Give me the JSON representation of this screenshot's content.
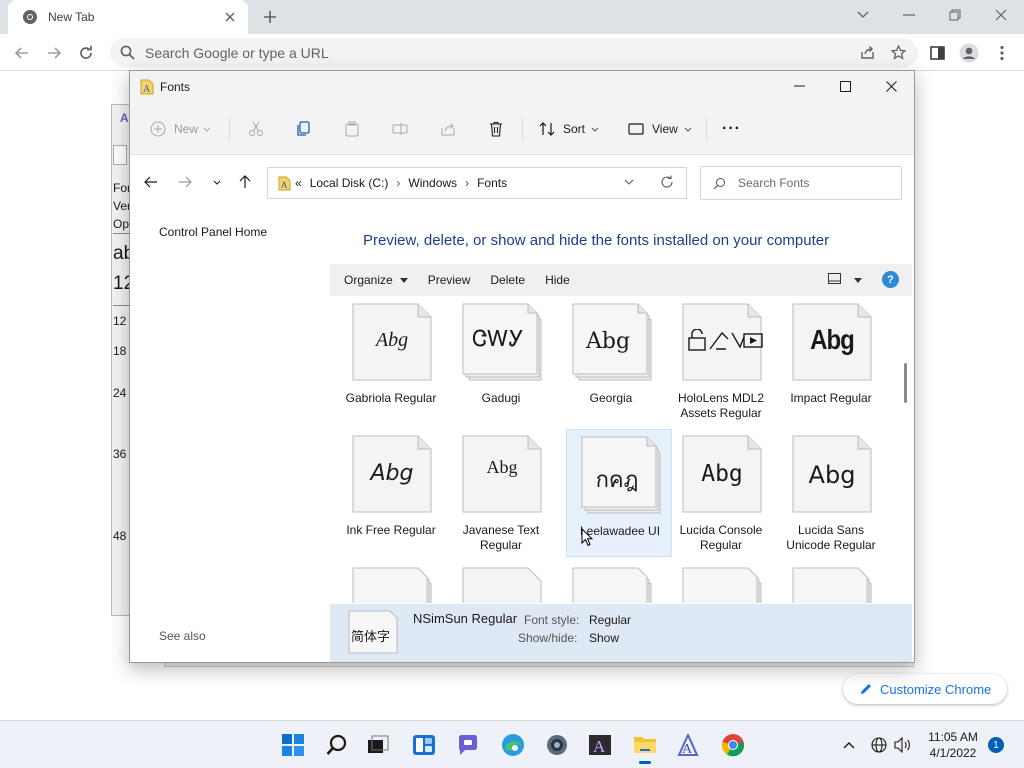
{
  "browser": {
    "tab_title": "New Tab",
    "omnibox_placeholder": "Search Google or type a URL",
    "customize_label": "Customize Chrome"
  },
  "background_window": {
    "lines": [
      "For",
      "Ver",
      "Op",
      "ab",
      "12",
      "12",
      "18",
      "24",
      "36",
      "48"
    ]
  },
  "explorer": {
    "title": "Fonts",
    "toolbar": {
      "new_label": "New",
      "sort_label": "Sort",
      "view_label": "View",
      "more_label": "···"
    },
    "address": {
      "overflow": "«",
      "segments": [
        "Local Disk (C:)",
        "Windows",
        "Fonts"
      ],
      "search_placeholder": "Search Fonts"
    },
    "left_pane": {
      "control_panel_home": "Control Panel Home",
      "see_also": "See also"
    },
    "heading": "Preview, delete, or show and hide the fonts installed on your computer",
    "command_bar": {
      "organize": "Organize",
      "preview": "Preview",
      "delete": "Delete",
      "hide": "Hide",
      "help": "?"
    },
    "fonts": [
      {
        "name": "Gabriola Regular",
        "sample": "Abg",
        "stack": false
      },
      {
        "name": "Gadugi",
        "sample": "ᏣᎳᎩ",
        "stack": true
      },
      {
        "name": "Georgia",
        "sample": "Abg",
        "stack": true
      },
      {
        "name": "HoloLens MDL2 Assets Regular",
        "sample": "",
        "stack": false
      },
      {
        "name": "Impact Regular",
        "sample": "Abg",
        "stack": false
      },
      {
        "name": "Ink Free Regular",
        "sample": "Abg",
        "stack": false
      },
      {
        "name": "Javanese Text Regular",
        "sample": "Abg",
        "stack": false
      },
      {
        "name": "Leelawadee UI",
        "sample": "กคฎ",
        "stack": true
      },
      {
        "name": "Lucida Console Regular",
        "sample": "Abg",
        "stack": false
      },
      {
        "name": "Lucida Sans Unicode Regular",
        "sample": "Abg",
        "stack": false
      }
    ],
    "details": {
      "thumb_sample": "简体字",
      "name": "NSimSun Regular",
      "font_style_label": "Font style:",
      "font_style_value": "Regular",
      "show_hide_label": "Show/hide:",
      "show_hide_value": "Show"
    }
  },
  "taskbar": {
    "time": "11:05 AM",
    "date": "4/1/2022",
    "notification_count": "1"
  },
  "colors": {
    "accent": "#005fb8",
    "heading": "#1e3e8a",
    "selection": "#e6f1fb",
    "details_pane": "#dfe8f5",
    "chrome_link": "#1a73e8"
  }
}
